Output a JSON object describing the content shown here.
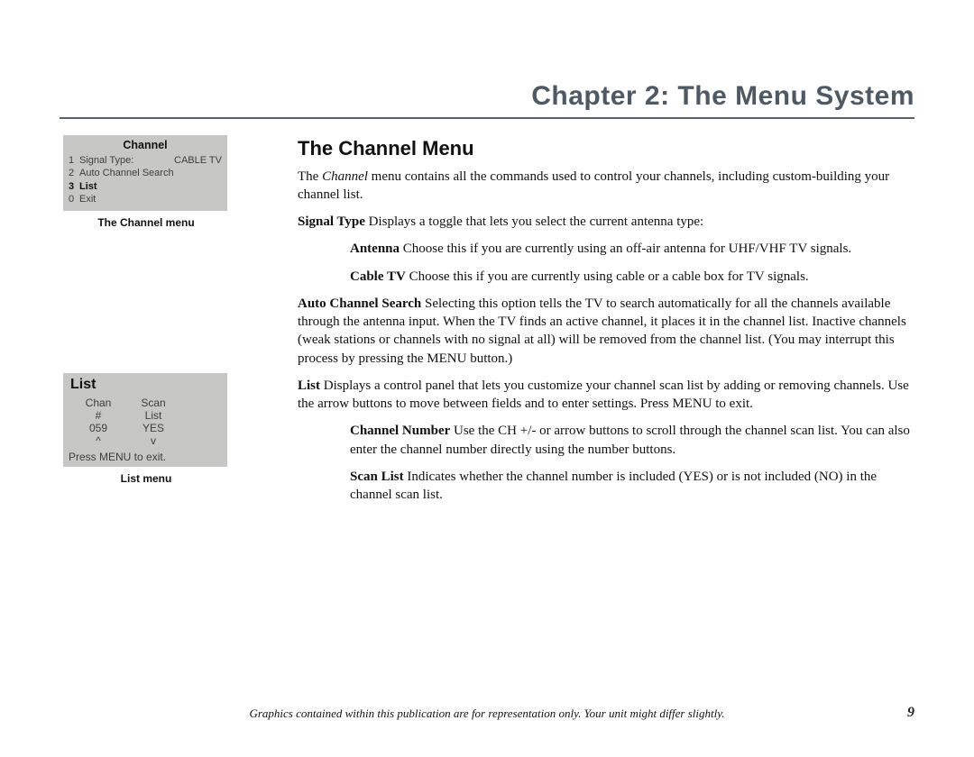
{
  "header": {
    "chapter_title": "Chapter 2: The Menu System"
  },
  "sidebar": {
    "channel_menu": {
      "title": "Channel",
      "rows": [
        {
          "idx": "1",
          "label": "Signal Type:",
          "value": "CABLE TV",
          "selected": false
        },
        {
          "idx": "2",
          "label": "Auto Channel Search",
          "value": "",
          "selected": false
        },
        {
          "idx": "3",
          "label": "List",
          "value": "",
          "selected": true
        },
        {
          "idx": "0",
          "label": "Exit",
          "value": "",
          "selected": false
        }
      ],
      "caption": "The Channel menu"
    },
    "list_menu": {
      "title": "List",
      "col1_header1": "Chan",
      "col1_header2": "#",
      "col2_header1": "Scan",
      "col2_header2": "List",
      "chan_value": "059",
      "scan_value": "YES",
      "arrow_up": "^",
      "arrow_down": "v",
      "exit_text": "Press MENU to exit.",
      "caption": "List menu"
    }
  },
  "content": {
    "section_title": "The Channel Menu",
    "intro_pre": "The ",
    "intro_em": "Channel",
    "intro_post": " menu contains all the commands used to control your channels, including custom-building your channel list.",
    "signal_type_label": "Signal Type",
    "signal_type_text": "  Displays a toggle that lets you select the current antenna type:",
    "antenna_label": "Antenna",
    "antenna_text": "  Choose this if you are currently using an off-air antenna for UHF/VHF TV signals.",
    "cable_label": "Cable TV",
    "cable_text": "  Choose this if you are currently using cable or a cable box for TV signals.",
    "auto_label": "Auto Channel Search",
    "auto_text": "  Selecting this option tells the TV to search automatically for all the channels available through the antenna input. When the TV finds an active channel, it places it in the channel list. Inactive channels (weak stations or channels with no signal at all) will be removed from the channel list. (You may interrupt this process by pressing the MENU button.)",
    "list_label": "List",
    "list_text": "  Displays a control panel that lets you customize your channel scan list by adding or removing channels. Use the arrow buttons to move between fields and to enter settings. Press MENU to exit.",
    "chnum_label": "Channel Number",
    "chnum_text": "  Use the CH +/-  or arrow buttons to scroll through the channel scan list. You can also enter the channel number directly using the number buttons.",
    "scan_label": "Scan List",
    "scan_text": "  Indicates whether the channel number is included (YES) or is not included (NO) in the channel scan list."
  },
  "footer": {
    "note": "Graphics contained within this publication are for representation only. Your unit might differ slightly.",
    "page": "9"
  }
}
